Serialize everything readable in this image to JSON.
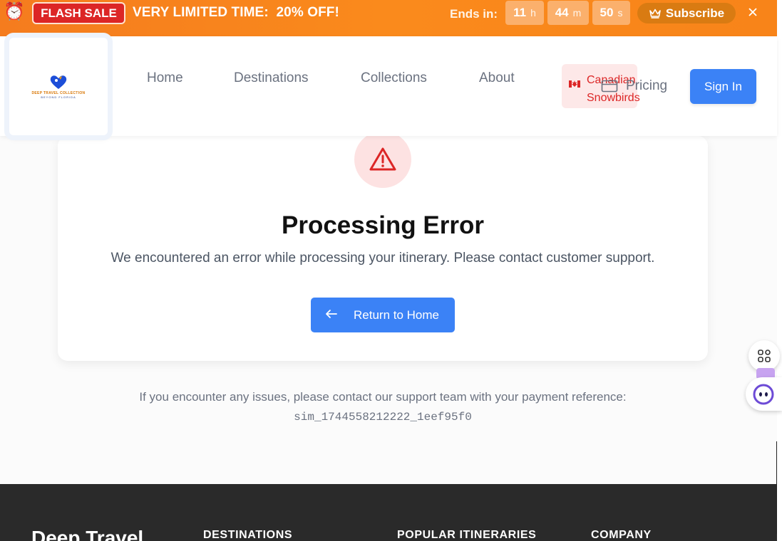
{
  "flash_banner": {
    "badge": "FLASH SALE",
    "message": "VERY LIMITED TIME:  20% OFF!",
    "ends_label": "Ends in:",
    "timer": [
      {
        "value": "11",
        "unit": "h"
      },
      {
        "value": "44",
        "unit": "m"
      },
      {
        "value": "50",
        "unit": "s"
      }
    ],
    "subscribe_label": "Subscribe",
    "colors": {
      "banner": "#f88419",
      "badge": "#dc2626"
    }
  },
  "header": {
    "logo": {
      "line1": "DEEP TRAVEL COLLECTION",
      "line2": "BEYOND FLORIDA"
    },
    "nav": [
      {
        "label": "Home"
      },
      {
        "label": "Destinations"
      },
      {
        "label": "Collections"
      },
      {
        "label": "About"
      }
    ],
    "canadian_snowbirds": "Canadian Snowbirds",
    "pricing_label": "Pricing",
    "signin_label": "Sign In"
  },
  "error_card": {
    "title": "Processing Error",
    "message": "We encountered an error while processing your itinerary. Please contact customer support.",
    "return_button": "Return to Home"
  },
  "support": {
    "text": "If you encounter any issues, please contact our support team with your payment reference:",
    "payment_reference": "sim_1744558212222_1eef95f0"
  },
  "footer": {
    "brand": "Deep Travel",
    "columns": [
      {
        "heading": "DESTINATIONS"
      },
      {
        "heading": "POPULAR ITINERARIES"
      },
      {
        "heading": "COMPANY"
      }
    ]
  },
  "colors": {
    "primary": "#3b82f6",
    "error": "#dc2626",
    "footer_bg": "#2a2a2a"
  }
}
